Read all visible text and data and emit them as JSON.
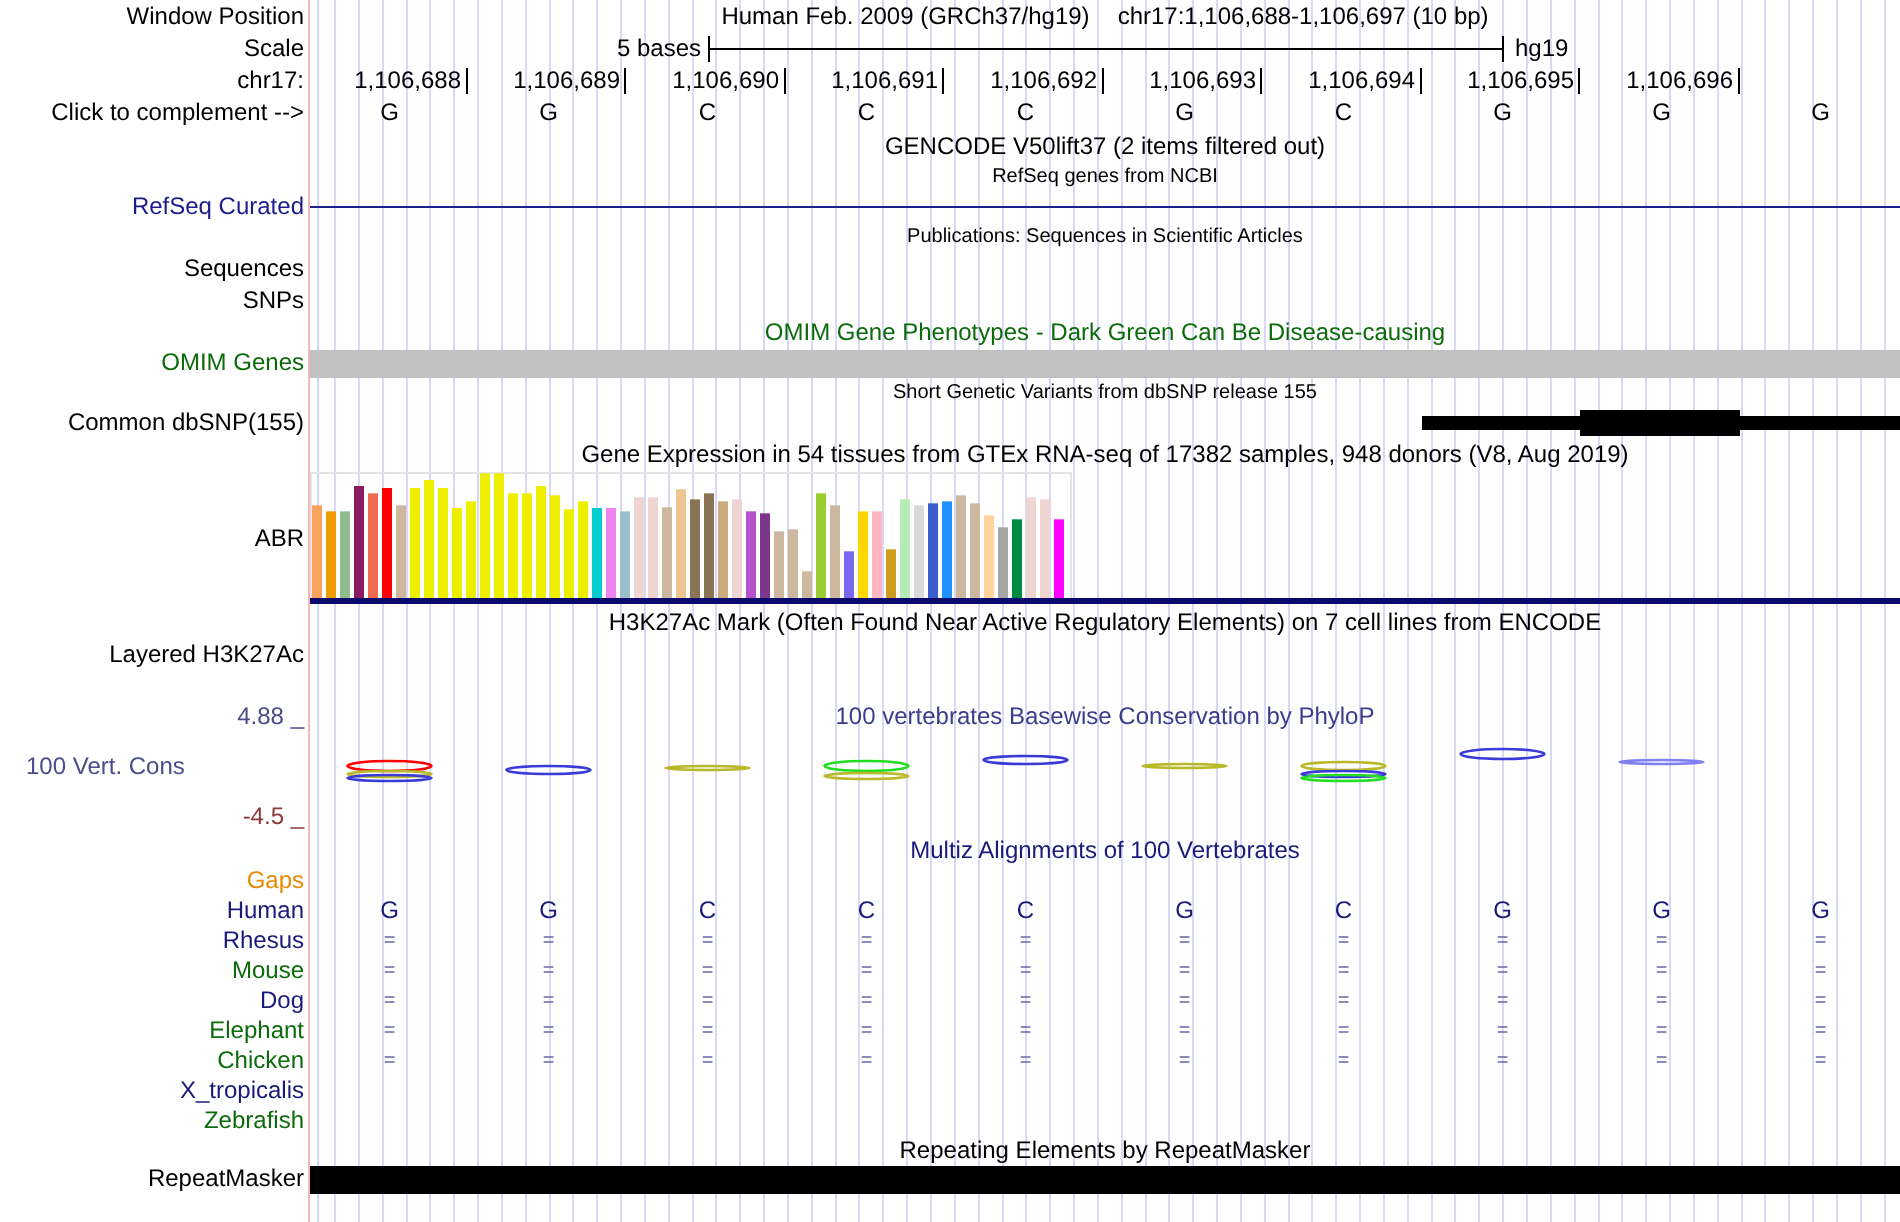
{
  "header": [
    {
      "kind": "position",
      "label": "Window Position",
      "assembly": "Human Feb. 2009 (GRCh37/hg19)",
      "position": "chr17:1,106,688-1,106,697 (10 bp)"
    },
    {
      "kind": "scale",
      "label": "Scale",
      "scale": "5 bases",
      "assembly": "hg19"
    },
    {
      "kind": "coordinates",
      "label": "chr17:",
      "values": [
        "1,106,688",
        "1,106,689",
        "1,106,690",
        "1,106,691",
        "1,106,692",
        "1,106,693",
        "1,106,694",
        "1,106,695",
        "1,106,696"
      ]
    },
    {
      "kind": "bases",
      "label": "Click to complement -->",
      "values": [
        "G",
        "G",
        "C",
        "C",
        "C",
        "G",
        "C",
        "G",
        "G",
        "G"
      ]
    }
  ],
  "tracks": [
    {
      "kind": "title",
      "text": "GENCODE V50lift37 (2 items filtered out)",
      "color": "#000000"
    },
    {
      "kind": "subtitle",
      "text": "RefSeq genes from NCBI"
    },
    {
      "kind": "line",
      "label": "RefSeq Curated",
      "color": "#1c1c8c"
    },
    {
      "kind": "subtitle",
      "text": "Publications: Sequences in Scientific Articles"
    },
    {
      "kind": "label",
      "label": "Sequences",
      "color": "#000000"
    },
    {
      "kind": "label",
      "label": "SNPs",
      "color": "#000000"
    },
    {
      "kind": "title",
      "text": "OMIM Gene Phenotypes - Dark Green Can Be Disease-causing",
      "color": "#0b6b0b"
    },
    {
      "kind": "band",
      "label": "OMIM Genes",
      "color": "#0b6b0b",
      "band": {
        "color": "#c0c0c0"
      }
    },
    {
      "kind": "subtitle",
      "text": "Short Genetic Variants from dbSNP release 155"
    },
    {
      "kind": "snp",
      "label": "Common dbSNP(155)",
      "color": "#000000"
    },
    {
      "kind": "title",
      "text": "Gene Expression in 54 tissues from GTEx RNA-seq of 17382 samples, 948 donors (V8, Aug 2019)",
      "color": "#000000"
    },
    {
      "kind": "expression",
      "label": "ABR",
      "color": "#000000"
    },
    {
      "kind": "title",
      "text": "H3K27Ac Mark (Often Found Near Active Regulatory Elements) on 7 cell lines from ENCODE",
      "color": "#000000"
    },
    {
      "kind": "label",
      "label": "Layered H3K27Ac",
      "color": "#000000"
    },
    {
      "kind": "conservation",
      "label": "100 Vert. Cons",
      "color": "#4b4b8c",
      "title": "100 vertebrates Basewise Conservation by PhyloP",
      "max": "4.88 _",
      "min": "-4.5 _"
    },
    {
      "kind": "title",
      "text": "Multiz Alignments of 100 Vertebrates",
      "color": "#1a1a7a"
    },
    {
      "kind": "species",
      "label": "Gaps",
      "color": "#e88a00"
    },
    {
      "kind": "species",
      "label": "Human",
      "color": "#1a1a7a",
      "bases": [
        "G",
        "G",
        "C",
        "C",
        "C",
        "G",
        "C",
        "G",
        "G",
        "G"
      ]
    },
    {
      "kind": "species",
      "label": "Rhesus",
      "color": "#1a1a7a",
      "bases": [
        "=",
        "=",
        "=",
        "=",
        "=",
        "=",
        "=",
        "=",
        "=",
        "="
      ]
    },
    {
      "kind": "species",
      "label": "Mouse",
      "color": "#0b6b0b",
      "bases": [
        "=",
        "=",
        "=",
        "=",
        "=",
        "=",
        "=",
        "=",
        "=",
        "="
      ]
    },
    {
      "kind": "species",
      "label": "Dog",
      "color": "#1a1a7a",
      "bases": [
        "=",
        "=",
        "=",
        "=",
        "=",
        "=",
        "=",
        "=",
        "=",
        "="
      ]
    },
    {
      "kind": "species",
      "label": "Elephant",
      "color": "#0b6b0b",
      "bases": [
        "=",
        "=",
        "=",
        "=",
        "=",
        "=",
        "=",
        "=",
        "=",
        "="
      ]
    },
    {
      "kind": "species",
      "label": "Chicken",
      "color": "#0b6b0b",
      "bases": [
        "=",
        "=",
        "=",
        "=",
        "=",
        "=",
        "=",
        "=",
        "=",
        "="
      ]
    },
    {
      "kind": "species",
      "label": "X_tropicalis",
      "color": "#1a1a7a"
    },
    {
      "kind": "species",
      "label": "Zebrafish",
      "color": "#0b6b0b"
    },
    {
      "kind": "subtitle-large",
      "text": "Repeating Elements by RepeatMasker"
    },
    {
      "kind": "band",
      "label": "RepeatMasker",
      "color": "#000000",
      "band": {
        "color": "#000000"
      }
    }
  ]
}
